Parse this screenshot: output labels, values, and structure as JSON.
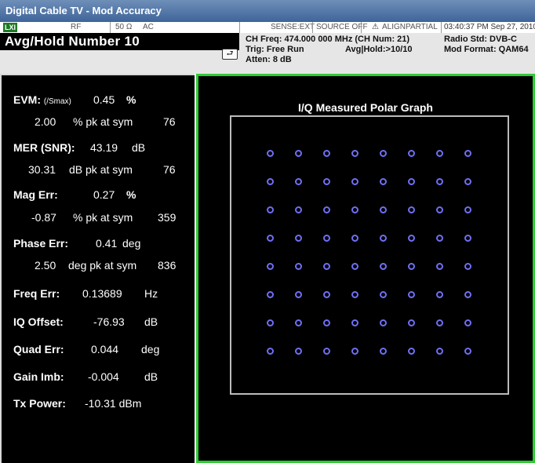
{
  "window": {
    "title": "Digital Cable TV - Mod Accuracy"
  },
  "status_bar": {
    "lxi": "LXI",
    "input": "RF",
    "impedance": "50 Ω",
    "coupling": "AC",
    "sense": "SENSE:EXT",
    "source": "SOURCE OFF",
    "align": "ALIGNPARTIAL",
    "datetime": "03:40:37 PM Sep 27, 2010"
  },
  "header": {
    "avg_hold": "Avg/Hold Number  10",
    "ch_freq": "CH Freq: 474.000 000 MHz (CH Num: 21)",
    "trig": "Trig: Free Run",
    "avg_hold_status": "Avg|Hold:>10/10",
    "atten": "Atten: 8 dB",
    "radio_std": "Radio Std: DVB-C",
    "mod_format": "Mod Format: QAM64"
  },
  "metrics": {
    "evm_label": "EVM:",
    "evm_unit_note": "(/Smax)",
    "evm_value": "0.45",
    "evm_unit": "%",
    "evm_pk_value": "2.00",
    "evm_pk_text": "% pk at sym",
    "evm_pk_sym": "76",
    "mer_label": "MER (SNR):",
    "mer_value": "43.19",
    "mer_unit": "dB",
    "mer_pk_value": "30.31",
    "mer_pk_text": "dB pk at sym",
    "mer_pk_sym": "76",
    "mag_label": "Mag Err:",
    "mag_value": "0.27",
    "mag_unit": "%",
    "mag_pk_value": "-0.87",
    "mag_pk_text": "% pk at sym",
    "mag_pk_sym": "359",
    "phase_label": "Phase Err:",
    "phase_value": "0.41",
    "phase_unit": "deg",
    "phase_pk_value": "2.50",
    "phase_pk_text": "deg pk at sym",
    "phase_pk_sym": "836",
    "freq_label": "Freq Err:",
    "freq_value": "0.13689",
    "freq_unit": "Hz",
    "iq_label": "IQ Offset:",
    "iq_value": "-76.93",
    "iq_unit": "dB",
    "quad_label": "Quad Err:",
    "quad_value": "0.044",
    "quad_unit": "deg",
    "gain_label": "Gain Imb:",
    "gain_value": "-0.004",
    "gain_unit": "dB",
    "tx_label": "Tx Power:",
    "tx_value": "-10.31 dBm"
  },
  "graph": {
    "title": "I/Q Measured Polar Graph",
    "constellation": "QAM64",
    "rows": 8,
    "cols": 8,
    "point_color": "#6f6ff5"
  }
}
